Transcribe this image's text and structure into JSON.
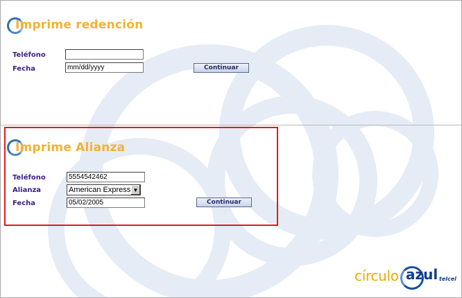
{
  "sections": {
    "redencion": {
      "title": "Imprime redención",
      "telefono_label": "Teléfono",
      "telefono_value": "",
      "fecha_label": "Fecha",
      "fecha_value": "mm/dd/yyyy",
      "continuar_label": "Continuar"
    },
    "alianza": {
      "title": "Imprime Alianza",
      "telefono_label": "Teléfono",
      "telefono_value": "5554542462",
      "alianza_label": "Alianza",
      "alianza_selected": "American Express",
      "fecha_label": "Fecha",
      "fecha_value": "05/02/2005",
      "continuar_label": "Continuar"
    }
  },
  "logo": {
    "brand_prefix": "círculo",
    "brand_main": "azul",
    "brand_suffix": "telcel"
  },
  "colors": {
    "title": "#f2b233",
    "label": "#3b1f86",
    "highlight": "#e01a1a",
    "logo_blue": "#123e8c",
    "logo_orange": "#f2a900"
  },
  "icons": {
    "title_mark": "ring-icon",
    "dropdown": "chevron-down-icon"
  }
}
